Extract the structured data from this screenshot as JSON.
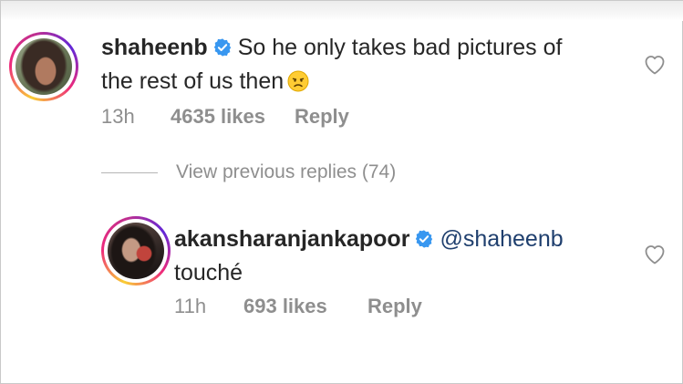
{
  "comments": [
    {
      "username": "shaheenb",
      "text_line1": "So he only takes bad pictures of",
      "text_line2": "the rest of us then",
      "emoji": "disappointed-face-icon",
      "time": "13h",
      "likes": "4635 likes",
      "reply": "Reply"
    },
    {
      "username": "akansharanjankapoor",
      "mention": "@shaheenb",
      "text": "touché",
      "time": "11h",
      "likes": "693 likes",
      "reply": "Reply"
    }
  ],
  "view_previous": "View previous replies (74)",
  "colors": {
    "verified": "#3897f0",
    "muted": "#8e8e8e",
    "mention": "#1f3f6e",
    "heart_stroke": "#8e8e8e"
  }
}
